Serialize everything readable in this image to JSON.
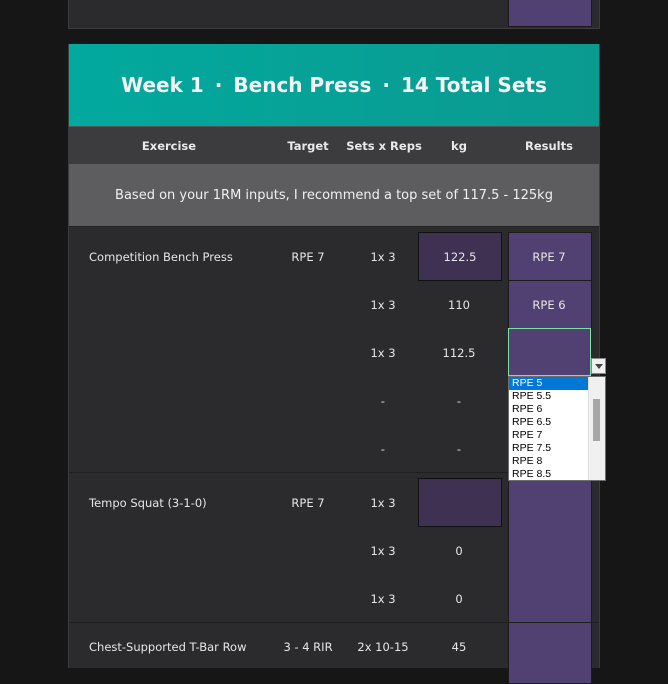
{
  "title": {
    "week": "Week 1",
    "separator": "·",
    "exercise": "Bench Press",
    "sets": "14 Total Sets"
  },
  "columns": {
    "exercise": "Exercise",
    "target": "Target",
    "sets_reps": "Sets x Reps",
    "kg": "kg",
    "results": "Results"
  },
  "recommendation": "Based on your 1RM inputs, I recommend a top set of 117.5 - 125kg",
  "exercises": [
    {
      "name": "Competition Bench Press",
      "target": "RPE 7",
      "rows": [
        {
          "sets": "1x 3",
          "kg": "122.5",
          "result": "RPE 7"
        },
        {
          "sets": "1x 3",
          "kg": "110",
          "result": "RPE 6"
        },
        {
          "sets": "1x 3",
          "kg": "112.5",
          "result": ""
        },
        {
          "sets": "-",
          "kg": "-",
          "result": ""
        },
        {
          "sets": "-",
          "kg": "-",
          "result": ""
        }
      ]
    },
    {
      "name": "Tempo Squat (3-1-0)",
      "target": "RPE 7",
      "rows": [
        {
          "sets": "1x 3",
          "kg": "",
          "result": ""
        },
        {
          "sets": "1x 3",
          "kg": "0",
          "result": ""
        },
        {
          "sets": "1x 3",
          "kg": "0",
          "result": ""
        }
      ]
    },
    {
      "name": "Chest-Supported T-Bar Row",
      "target": "3 - 4 RIR",
      "rows": [
        {
          "sets": "2x 10-15",
          "kg": "45",
          "result": ""
        }
      ]
    }
  ],
  "dropdown": {
    "options": [
      "RPE 5",
      "RPE 5.5",
      "RPE 6",
      "RPE 6.5",
      "RPE 7",
      "RPE 7.5",
      "RPE 8",
      "RPE 8.5"
    ],
    "selected": "RPE 5"
  },
  "colors": {
    "title_bar": "#02a99e",
    "results_cell": "#514072",
    "kg_input": "#3e3152",
    "selection_border": "#7fe0a0"
  }
}
